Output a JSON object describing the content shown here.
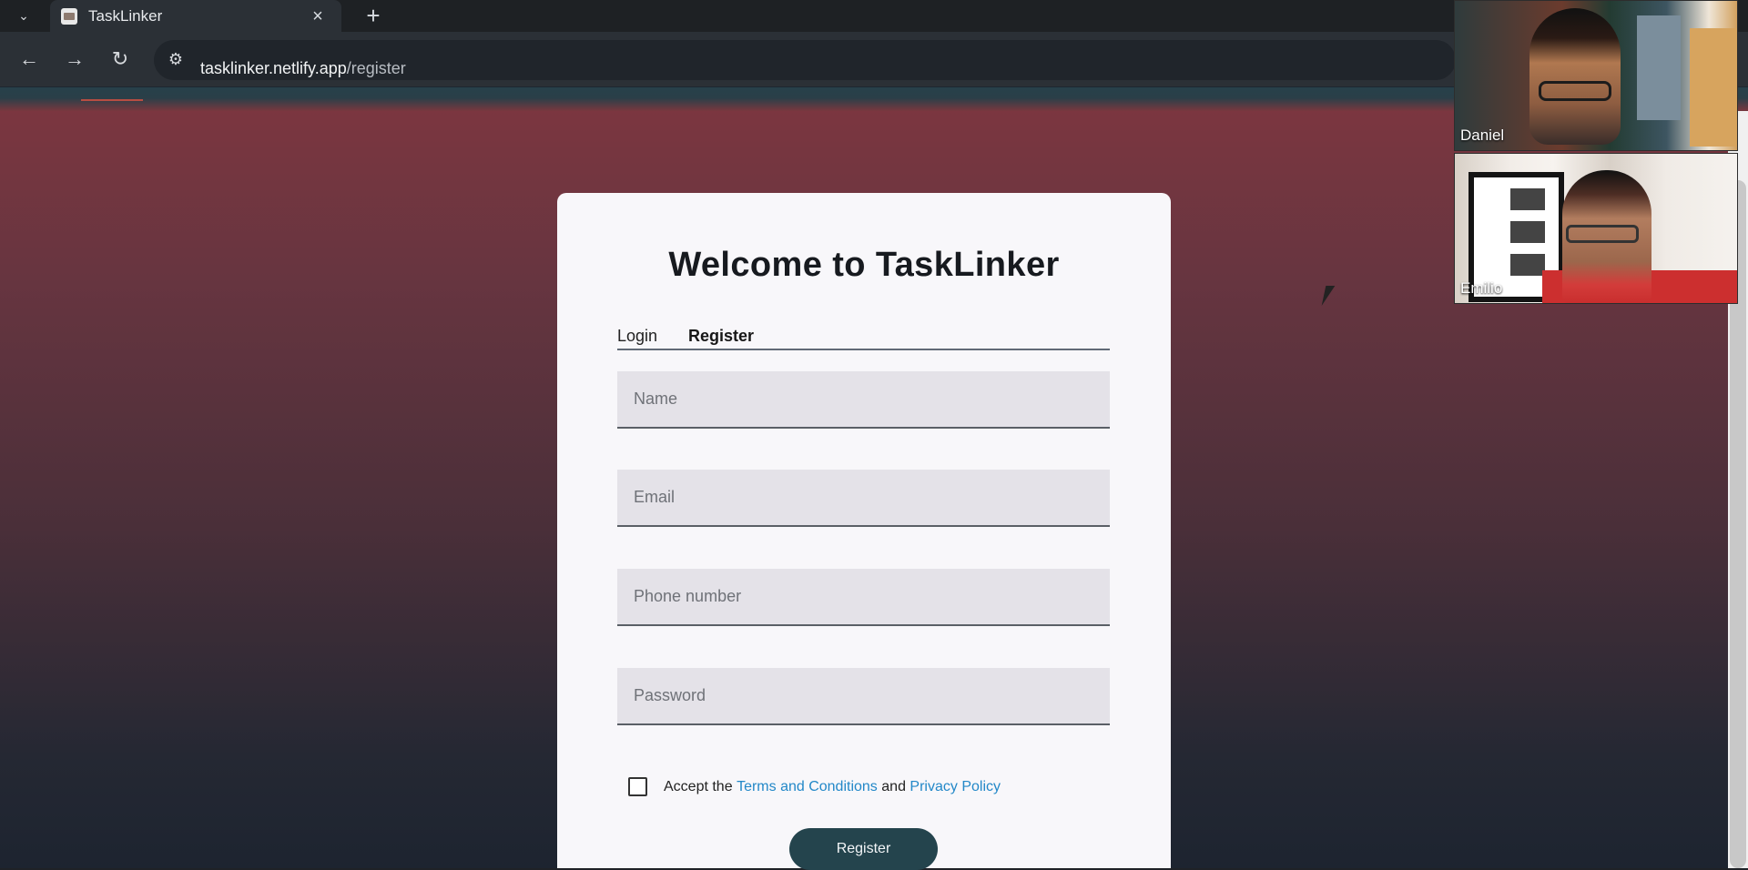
{
  "browser": {
    "tab": {
      "title": "TaskLinker",
      "close_icon": "close-icon"
    },
    "new_tab_icon": "plus-icon",
    "url": {
      "domain": "tasklinker.netlify.app",
      "path": "/register"
    }
  },
  "page": {
    "heading": "Welcome to TaskLinker",
    "tabs": [
      {
        "label": "Login"
      },
      {
        "label": "Register"
      }
    ],
    "fields": {
      "name_placeholder": "Name",
      "email_placeholder": "Email",
      "phone_placeholder": "Phone number",
      "password_placeholder": "Password"
    },
    "terms": {
      "prefix": "Accept the",
      "terms_link": "Terms and Conditions",
      "middle": "and",
      "privacy_link": "Privacy Policy"
    },
    "register_button": "Register"
  },
  "call": {
    "participants": [
      {
        "name": "Daniel"
      },
      {
        "name": "Emilio"
      }
    ]
  },
  "colors": {
    "accent": "#24444d",
    "link": "#2388c8",
    "background_top": "#7b3640",
    "background_bottom": "#1d2430"
  }
}
